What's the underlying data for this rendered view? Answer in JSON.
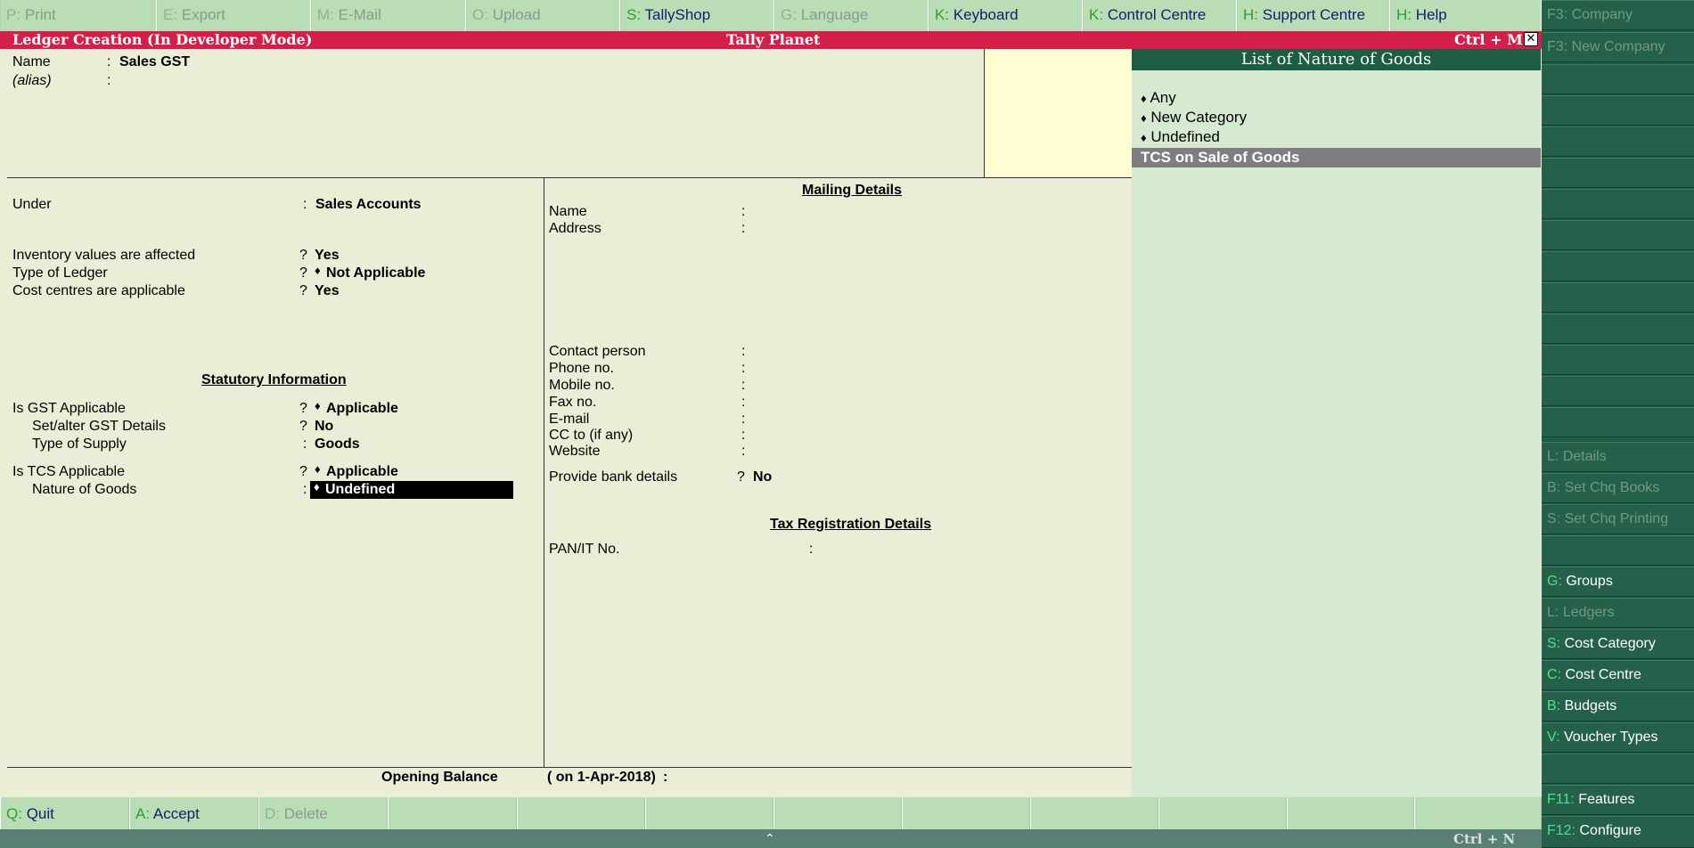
{
  "toolbar": [
    {
      "key": "P",
      "label": "Print",
      "enabled": false
    },
    {
      "key": "E",
      "label": "Export",
      "enabled": false
    },
    {
      "key": "M",
      "label": "E-Mail",
      "enabled": false
    },
    {
      "key": "O",
      "label": "Upload",
      "enabled": false
    },
    {
      "key": "S",
      "label": "TallyShop",
      "enabled": true
    },
    {
      "key": "G",
      "label": "Language",
      "enabled": false
    },
    {
      "key": "K",
      "label": "Keyboard",
      "enabled": true
    },
    {
      "key": "K",
      "label": "Control Centre",
      "enabled": true
    },
    {
      "key": "H",
      "label": "Support Centre",
      "enabled": true
    },
    {
      "key": "H",
      "label": "Help",
      "enabled": true
    }
  ],
  "sidebar": {
    "f3_company": {
      "key": "F3",
      "label": "Company"
    },
    "f3_new_company": {
      "key": "F3",
      "label": "New Company"
    },
    "details": {
      "key": "L",
      "label": "Details"
    },
    "set_chq_books": {
      "key": "B",
      "label": "Set Chq Books"
    },
    "set_chq_printing": {
      "key": "S",
      "label": "Set Chq Printing"
    },
    "groups": {
      "key": "G",
      "label": "Groups"
    },
    "ledgers": {
      "key": "L",
      "label": "Ledgers"
    },
    "cost_category": {
      "key": "S",
      "label": "Cost Category"
    },
    "cost_centre": {
      "key": "C",
      "label": "Cost Centre"
    },
    "budgets": {
      "key": "B",
      "label": "Budgets"
    },
    "voucher_types": {
      "key": "V",
      "label": "Voucher Types"
    },
    "features": {
      "key": "F11",
      "label": "Features"
    },
    "configure": {
      "key": "F12",
      "label": "Configure"
    }
  },
  "titlebar": {
    "left": "Ledger Creation (In Developer Mode)",
    "center": "Tally Planet",
    "shortcut": "Ctrl + M",
    "close_glyph": "✕"
  },
  "ledger": {
    "name_label": "Name",
    "name_value": "Sales GST",
    "alias_label": "(alias)",
    "colon": ":",
    "qmark": "?",
    "diamond": "♦",
    "under_label": "Under",
    "under_value": "Sales Accounts",
    "inventory_label": "Inventory values are affected",
    "inventory_value": "Yes",
    "type_label": "Type of Ledger",
    "type_value": "Not Applicable",
    "costcentres_label": "Cost centres are applicable",
    "costcentres_value": "Yes",
    "statutory_heading": "Statutory Information",
    "gst_applicable_label": "Is GST Applicable",
    "gst_applicable_value": "Applicable",
    "gst_details_label": "Set/alter GST Details",
    "gst_details_value": "No",
    "supply_label": "Type of Supply",
    "supply_value": "Goods",
    "tcs_label": "Is TCS Applicable",
    "tcs_value": "Applicable",
    "nature_label": "Nature of Goods",
    "nature_value": "Undefined"
  },
  "mailing": {
    "heading": "Mailing Details",
    "name": "Name",
    "address": "Address",
    "contact": "Contact person",
    "phone": "Phone no.",
    "mobile": "Mobile no.",
    "fax": "Fax no.",
    "email": "E-mail",
    "cc": "CC to (if any)",
    "website": "Website",
    "bank_label": "Provide bank details",
    "bank_value": "No",
    "tax_heading": "Tax Registration Details",
    "pan_label": "PAN/IT No."
  },
  "opening": {
    "label": "Opening Balance",
    "date": "( on 1-Apr-2018)",
    "colon": ":"
  },
  "nature_list": {
    "title": "List of Nature of Goods",
    "items": [
      "Any",
      "New Category",
      "Undefined"
    ],
    "selected": "TCS on Sale of Goods"
  },
  "bottombar": [
    {
      "key": "Q",
      "label": "Quit",
      "enabled": true
    },
    {
      "key": "A",
      "label": "Accept",
      "enabled": true
    },
    {
      "key": "D",
      "label": "Delete",
      "enabled": false
    }
  ],
  "status": {
    "caret": "⌃",
    "shortcut": "Ctrl + N"
  }
}
